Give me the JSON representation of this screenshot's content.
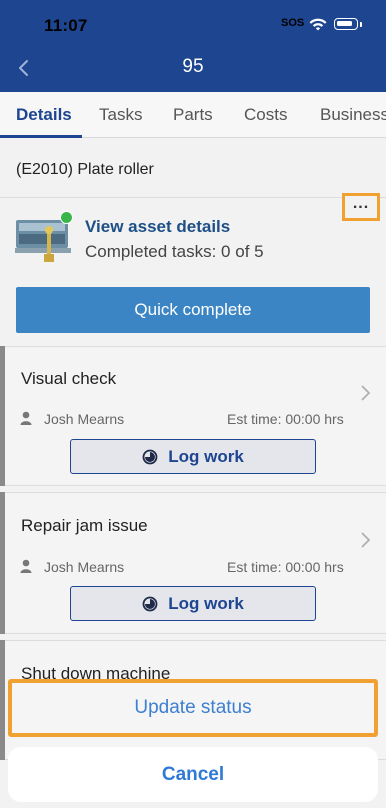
{
  "status_bar": {
    "time": "11:07",
    "sos": "SOS"
  },
  "header": {
    "title": "95"
  },
  "tabs": [
    {
      "label": "Details",
      "active": true
    },
    {
      "label": "Tasks",
      "active": false
    },
    {
      "label": "Parts",
      "active": false
    },
    {
      "label": "Costs",
      "active": false
    },
    {
      "label": "Business",
      "active": false
    }
  ],
  "asset": {
    "name": "(E2010) Plate roller",
    "link_label": "View asset details",
    "tasks_summary": "Completed tasks: 0 of 5",
    "status_color": "#39b54a"
  },
  "quick_complete_label": "Quick complete",
  "tasks": [
    {
      "name": "Visual check",
      "assignee": "Josh Mearns",
      "est_time": "Est time: 00:00 hrs",
      "log_label": "Log work"
    },
    {
      "name": "Repair jam issue",
      "assignee": "Josh Mearns",
      "est_time": "Est time: 00:00 hrs",
      "log_label": "Log work"
    },
    {
      "name": "Shut down machine"
    }
  ],
  "action_sheet": {
    "update_label": "Update status",
    "cancel_label": "Cancel"
  },
  "colors": {
    "header": "#1e4590",
    "accent": "#3b85c4",
    "highlight": "#f0a131"
  }
}
